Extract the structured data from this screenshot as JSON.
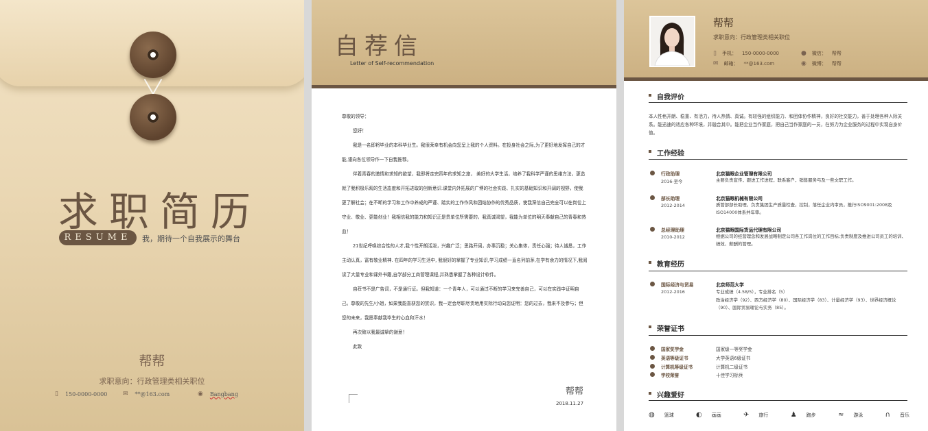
{
  "cover": {
    "title": "求职简历",
    "resume_label": "RESUME",
    "slogan": "我，期待一个自我展示的舞台",
    "name": "帮帮",
    "intent": "求职意向：行政管理类相关职位",
    "phone": "150-0000-0000",
    "email": "**@163.com",
    "weibo": "Bangbang"
  },
  "letter": {
    "title": "自荐信",
    "subtitle": "Letter of Self-recommendation",
    "greeting": "尊敬的领导：",
    "hello": "您好！",
    "paragraphs": [
      "我是一名即将毕业的本科毕业生。我很荣幸有机会向您呈上我的个人资料。在投身社会之际,为了更好地发挥自己的才能,谨向各位领导作一下自我推荐。",
      "伴着青春的激情和求知的欲望，我即将走完四年的求知之旅， 美好的大学生活，培养了我科学严谨的思维方法，更造就了我积极乐观的生活态度和开拓进取的创新意识.课堂内外拓展的广博的社会实践、扎实的基础知识和开阔的视野，使我更了解社会；在不断的学习和工作中养成的严谨、踏实的工作作风和团结协作的优秀品质，使我深信自己完全可以在岗位上守业、敬业、更能创业！我相信我的能力和知识正是贵单位所需要的，我真诚渴望，我能为单位的明天奉献自己的青春和热血！",
      "21世纪呼唤综合性的人才,我个性开朗活泼，兴趣广泛；思路开阔，办事沉稳；关心集体，责任心强；待人诚恳，工作主动认真，富有敬业精神. 在四年的学习生活中, 我很好的掌握了专业知识,学习成绩一直名列前茅,在学有余力的情况下,我阅读了大量专业和课外书籍,自学部分工商管理课程,并熟悉掌握了各种设计软件。",
      "自荐书不是广告词，不是通行证。但我知道：一个青年人，可以通过不断的学习来完善自己，可以在实践中证明自己。尊敬的先生/小姐，如果我能喜获您的赏识，我一定会尽职尽责地用实际行动向您证明：您的过去，我来不及参与；但您的未来，我愿奉献我毕生的心血和汗水！",
      "再次致以我最诚挚的谢意！"
    ],
    "closing": "此致",
    "signature": "帮帮",
    "date": "2018.11.27"
  },
  "resume": {
    "name": "帮帮",
    "intent": "求职意向：行政管理类相关职位",
    "phone_label": "手机：",
    "phone": "150-0000-0000",
    "email_label": "邮箱：",
    "email": "**@163.com",
    "wechat_label": "微信：",
    "wechat": "帮帮",
    "weibo_label": "微博：",
    "weibo": "帮帮",
    "sections": {
      "self_eval": "自我评价",
      "work": "工作经验",
      "education": "教育经历",
      "honors": "荣誉证书",
      "hobbies": "兴趣爱好"
    },
    "self_eval_text": "本人性格开朗、稳重、有活力，待人热情、真诚。有较强的组织能力、和团体协作精神，良好的社交能力，善于处理各种人际关系。能迅速的适应各种环境，并融合其中。能把企业当作家庭，把自己当作家庭的一员，在努力为企业服务的过程中实现自身价值。",
    "work": [
      {
        "role": "行政助理",
        "date": "2016-至今",
        "org": "北京猫眼企业管理有限公司",
        "desc": "主要负责宣传，跟进工作进程，联系客户，销售服务与及一些文职工作。"
      },
      {
        "role": "部长助理",
        "date": "2012-2014",
        "org": "北京猫眼机械有限公司",
        "desc": "质管部部长助理，负责集团生产质量检查，控制，落任企业内审员，推行ISO9001:2008及ISO14000体系并年审。"
      },
      {
        "role": "总经理助理",
        "date": "2010-2012",
        "org": "北京猫眼国际货运代理有限公司",
        "desc": "根据公司的经营理念和发展战略制定公司各工作岗位的工作目标;负责制度及推进公司员工的培训、绩效、薪酬的管理。"
      }
    ],
    "education": {
      "major": "国际经济与贸易",
      "date": "2012-2016",
      "school": "北京师范大学",
      "gpa": "专业成绩（4.58/5），专业排名（5）",
      "courses": "政治经济学（92）、西方经济学（80）、国际经济学（83）、计量经济学（93）、世界经济概论（90）、国际贸易理论与实务（85）。"
    },
    "honors": [
      {
        "name": "国家奖学金",
        "value": "国家级一等奖学金"
      },
      {
        "name": "英语等级证书",
        "value": "大学英语6级证书"
      },
      {
        "name": "计算机等级证书",
        "value": "计算机二级证书"
      },
      {
        "name": "学校荣誉",
        "value": "十佳学习标兵"
      }
    ],
    "hobbies": [
      {
        "icon": "ball-icon",
        "label": "篮球"
      },
      {
        "icon": "palette-icon",
        "label": "画画"
      },
      {
        "icon": "plane-icon",
        "label": "旅行"
      },
      {
        "icon": "runner-icon",
        "label": "跑步"
      },
      {
        "icon": "swim-icon",
        "label": "游泳"
      },
      {
        "icon": "headphones-icon",
        "label": "音乐"
      }
    ]
  },
  "colors": {
    "brown": "#6b5643",
    "tan": "#dcc59a",
    "paper": "#ffffff"
  }
}
